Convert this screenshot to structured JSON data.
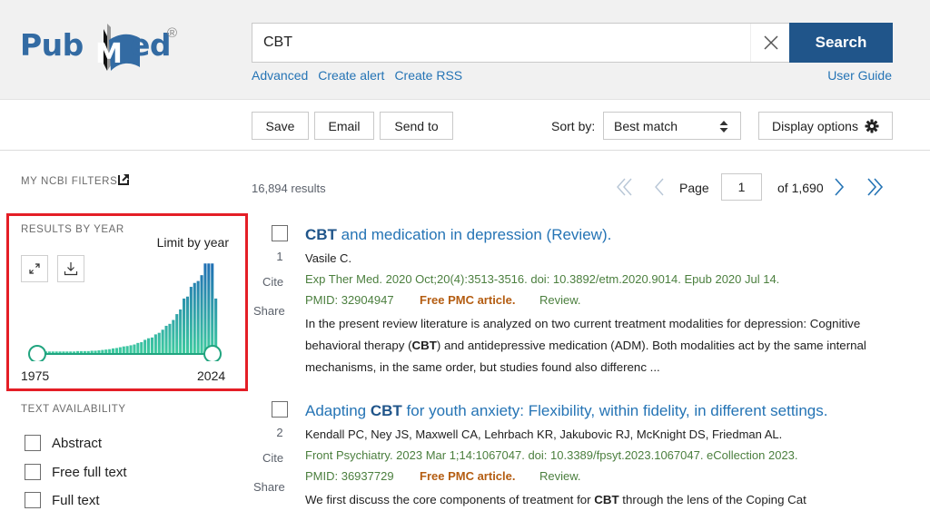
{
  "header": {
    "logo_text": "PubMed",
    "logo_registered": "®",
    "search_value": "CBT",
    "search_placeholder": "",
    "search_button": "Search",
    "links": [
      "Advanced",
      "Create alert",
      "Create RSS"
    ],
    "user_guide": "User Guide"
  },
  "toolbar": {
    "save": "Save",
    "email": "Email",
    "send_to": "Send to",
    "sort_label": "Sort by:",
    "sort_value": "Best match",
    "display_options": "Display options"
  },
  "sidebar": {
    "my_ncbi_filters": "MY NCBI FILTERS",
    "results_by_year": "RESULTS BY YEAR",
    "limit_by_year": "Limit by year",
    "year_start": "1975",
    "year_end": "2024",
    "text_availability": "TEXT AVAILABILITY",
    "filters": [
      {
        "label": "Abstract",
        "checked": false
      },
      {
        "label": "Free full text",
        "checked": false
      },
      {
        "label": "Full text",
        "checked": false
      }
    ]
  },
  "chart_data": {
    "type": "bar",
    "title": "Results by year",
    "x_start": 1975,
    "x_end": 2024,
    "values": [
      4,
      4,
      4,
      4,
      4,
      4,
      4,
      4,
      4,
      4,
      5,
      5,
      5,
      5,
      6,
      6,
      7,
      8,
      9,
      10,
      12,
      13,
      15,
      17,
      18,
      20,
      22,
      26,
      28,
      34,
      38,
      40,
      48,
      52,
      60,
      70,
      75,
      85,
      100,
      112,
      140,
      145,
      170,
      180,
      185,
      200,
      230,
      230,
      230,
      140
    ],
    "ylim": [
      0,
      240
    ],
    "colors": {
      "low": "#3ecba0",
      "high": "#1f6bb5"
    }
  },
  "results": {
    "count": "16,894 results",
    "page_label": "Page",
    "page_value": "1",
    "page_of": "of 1,690",
    "items": [
      {
        "number": "1",
        "title_bold": "CBT",
        "title_rest": " and medication in depression (Review).",
        "authors": "Vasile C.",
        "citation": "Exp Ther Med. 2020 Oct;20(4):3513-3516. doi: 10.3892/etm.2020.9014. Epub 2020 Jul 14.",
        "pmid": "PMID: 32904947",
        "free": "Free PMC article.",
        "type": "Review.",
        "snippet_pre": "In the present review literature is analyzed on two current treatment modalities for depression: Cognitive behavioral therapy (",
        "snippet_bold": "CBT",
        "snippet_post": ") and antidepressive medication (ADM). Both modalities act by the same internal mechanisms, in the same order, but studies found also differenc ...",
        "cite": "Cite",
        "share": "Share"
      },
      {
        "number": "2",
        "title_pre": "Adapting ",
        "title_bold": "CBT",
        "title_rest": " for youth anxiety: Flexibility, within fidelity, in different settings.",
        "authors": "Kendall PC, Ney JS, Maxwell CA, Lehrbach KR, Jakubovic RJ, McKnight DS, Friedman AL.",
        "citation": "Front Psychiatry. 2023 Mar 1;14:1067047. doi: 10.3389/fpsyt.2023.1067047. eCollection 2023.",
        "pmid": "PMID: 36937729",
        "free": "Free PMC article.",
        "type": "Review.",
        "snippet_pre": "We first discuss the core components of treatment for ",
        "snippet_bold": "CBT",
        "snippet_post": " through the lens of the Coping Cat",
        "cite": "Cite",
        "share": "Share"
      }
    ]
  }
}
